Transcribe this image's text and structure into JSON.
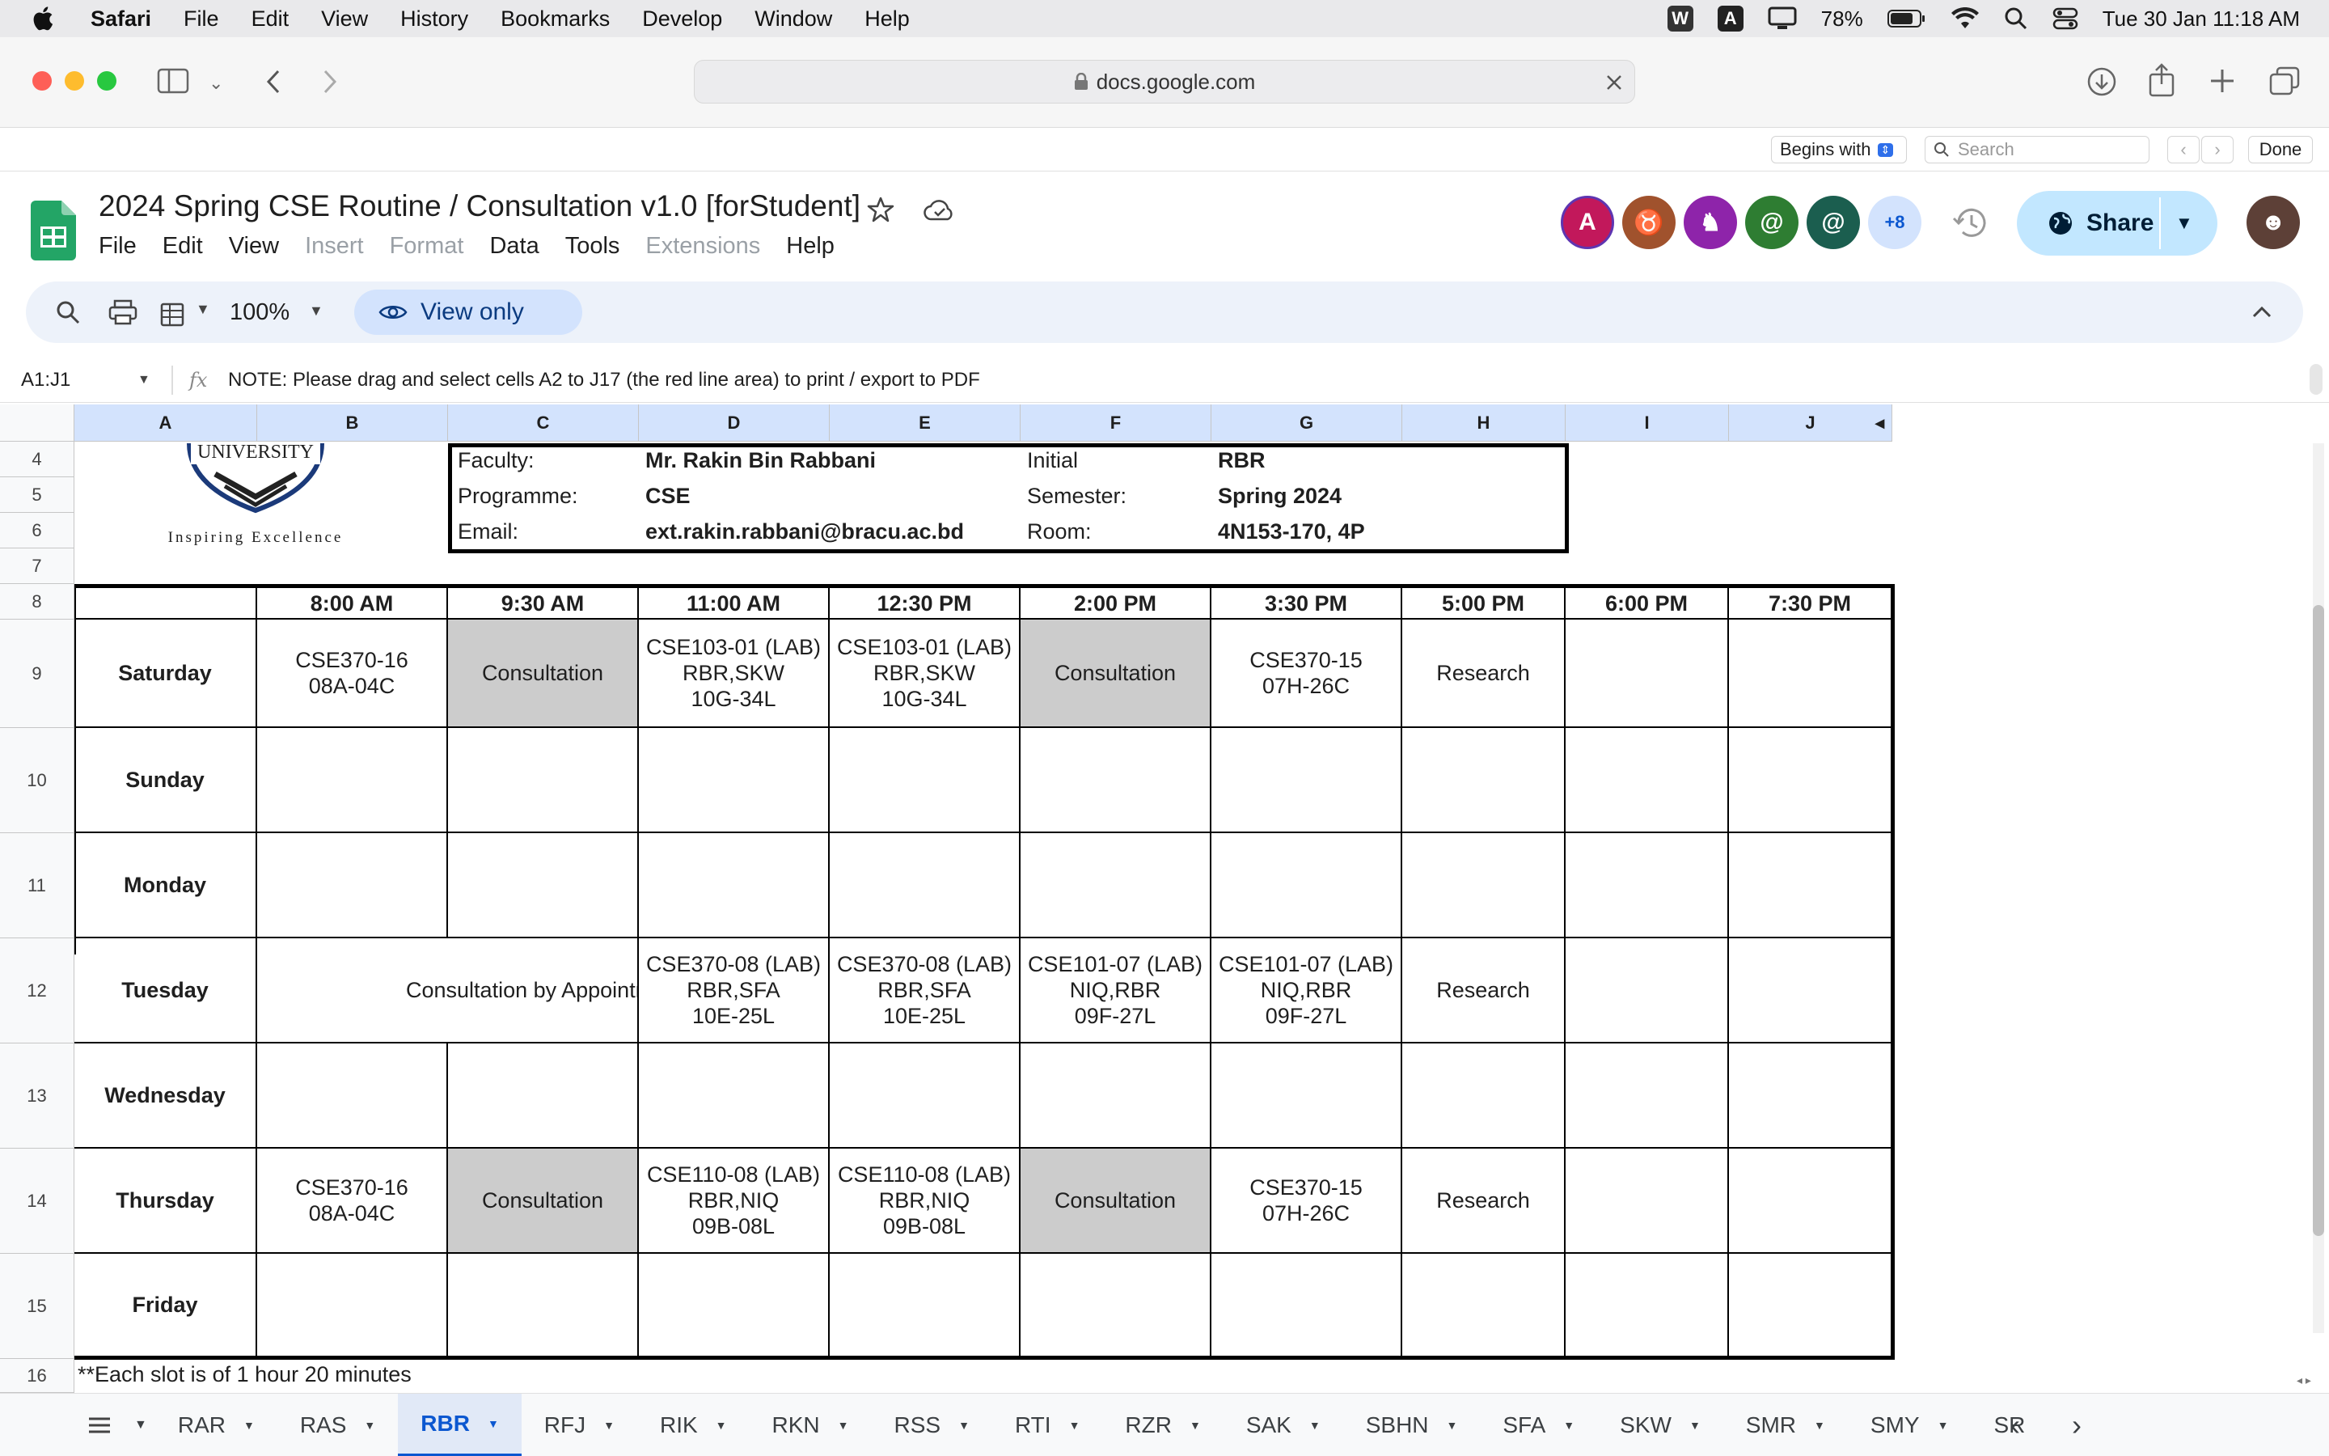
{
  "menubar": {
    "app": "Safari",
    "items": [
      "File",
      "Edit",
      "View",
      "History",
      "Bookmarks",
      "Develop",
      "Window",
      "Help"
    ],
    "battery": "78%",
    "datetime": "Tue 30 Jan  11:18 AM"
  },
  "safari": {
    "url": "docs.google.com"
  },
  "findbar": {
    "mode": "Begins with",
    "placeholder": "Search",
    "done": "Done"
  },
  "doc": {
    "title": "2024 Spring CSE Routine / Consultation v1.0 [forStudent]",
    "menu": [
      "File",
      "Edit",
      "View",
      "Insert",
      "Format",
      "Data",
      "Tools",
      "Extensions",
      "Help"
    ],
    "avatar_letter": "A",
    "more_count": "+8",
    "share": "Share"
  },
  "toolbar": {
    "zoom": "100%",
    "view_only": "View only"
  },
  "formula": {
    "name_box": "A1:J1",
    "content": "NOTE: Please drag and select cells A2 to J17 (the red line area) to print / export to PDF"
  },
  "columns": [
    "A",
    "B",
    "C",
    "D",
    "E",
    "F",
    "G",
    "H",
    "I",
    "J"
  ],
  "rows": [
    "4",
    "5",
    "6",
    "7",
    "8",
    "9",
    "10",
    "11",
    "12",
    "13",
    "14",
    "15",
    "16"
  ],
  "logo": {
    "name": "UNIVERSITY",
    "tagline": "Inspiring Excellence"
  },
  "info": {
    "faculty_label": "Faculty:",
    "faculty": "Mr. Rakin Bin Rabbani",
    "initial_label": "Initial",
    "initial": "RBR",
    "programme_label": "Programme:",
    "programme": "CSE",
    "semester_label": "Semester:",
    "semester": "Spring 2024",
    "email_label": "Email:",
    "email": "ext.rakin.rabbani@bracu.ac.bd",
    "room_label": "Room:",
    "room": "4N153-170, 4P"
  },
  "schedule": {
    "times": [
      "8:00 AM",
      "9:30 AM",
      "11:00 AM",
      "12:30 PM",
      "2:00 PM",
      "3:30 PM",
      "5:00 PM",
      "6:00 PM",
      "7:30 PM"
    ],
    "days": [
      {
        "day": "Saturday",
        "slots": [
          "CSE370-16\n08A-04C",
          "Consultation",
          "CSE103-01 (LAB)\nRBR,SKW\n10G-34L",
          "CSE103-01 (LAB)\nRBR,SKW\n10G-34L",
          "Consultation",
          "CSE370-15\n07H-26C",
          "Research",
          "",
          ""
        ]
      },
      {
        "day": "Sunday",
        "slots": [
          "",
          "",
          "",
          "",
          "",
          "",
          "",
          "",
          ""
        ]
      },
      {
        "day": "Monday",
        "slots": [
          "",
          "",
          "",
          "",
          "",
          "",
          "",
          "",
          ""
        ]
      },
      {
        "day": "Tuesday",
        "merged": "Consultation by Appointment",
        "slots": [
          "",
          "",
          "CSE370-08 (LAB)\nRBR,SFA\n10E-25L",
          "CSE370-08 (LAB)\nRBR,SFA\n10E-25L",
          "CSE101-07 (LAB)\nNIQ,RBR\n09F-27L",
          "CSE101-07 (LAB)\nNIQ,RBR\n09F-27L",
          "Research",
          "",
          ""
        ]
      },
      {
        "day": "Wednesday",
        "slots": [
          "",
          "",
          "",
          "",
          "",
          "",
          "",
          "",
          ""
        ]
      },
      {
        "day": "Thursday",
        "slots": [
          "CSE370-16\n08A-04C",
          "Consultation",
          "CSE110-08 (LAB)\nRBR,NIQ\n09B-08L",
          "CSE110-08 (LAB)\nRBR,NIQ\n09B-08L",
          "Consultation",
          "CSE370-15\n07H-26C",
          "Research",
          "",
          ""
        ]
      },
      {
        "day": "Friday",
        "slots": [
          "",
          "",
          "",
          "",
          "",
          "",
          "",
          "",
          ""
        ]
      }
    ],
    "footnote": "**Each slot is of 1 hour 20 minutes"
  },
  "sheet_tabs": [
    "RAR",
    "RAS",
    "RBR",
    "RFJ",
    "RIK",
    "RKN",
    "RSS",
    "RTI",
    "RZR",
    "SAK",
    "SBHN",
    "SFA",
    "SKW",
    "SMR",
    "SMY",
    "SR"
  ],
  "active_tab": "RBR",
  "colors": {
    "accent": "#0b57d0",
    "share_bg": "#c2e7ff",
    "grey_cell": "#cccccc"
  }
}
